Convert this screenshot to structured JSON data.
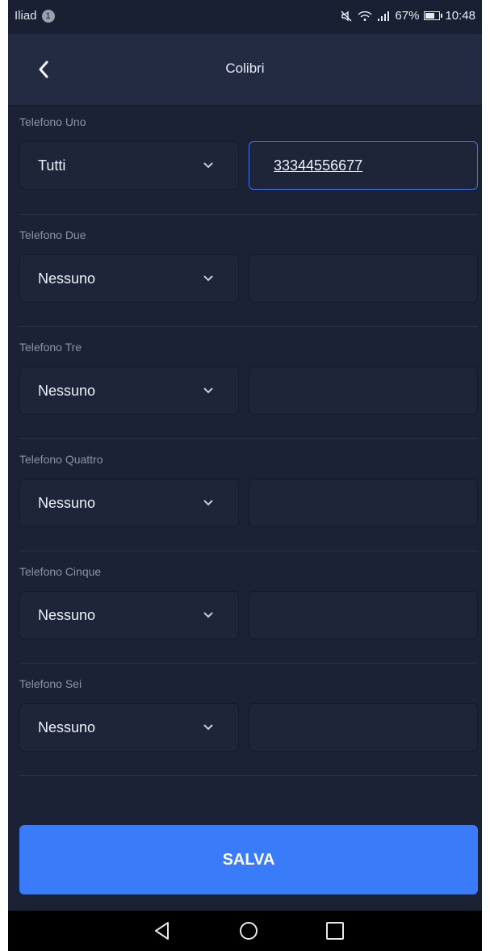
{
  "status_bar": {
    "carrier": "Iliad",
    "notification_count": "1",
    "battery": "67%",
    "time": "10:48",
    "battery_level": 0.67
  },
  "header": {
    "title": "Colibri"
  },
  "phones": [
    {
      "label": "Telefono Uno",
      "selected": "Tutti",
      "number": "33344556677"
    },
    {
      "label": "Telefono Due",
      "selected": "Nessuno",
      "number": ""
    },
    {
      "label": "Telefono Tre",
      "selected": "Nessuno",
      "number": ""
    },
    {
      "label": "Telefono Quattro",
      "selected": "Nessuno",
      "number": ""
    },
    {
      "label": "Telefono Cinque",
      "selected": "Nessuno",
      "number": ""
    },
    {
      "label": "Telefono Sei",
      "selected": "Nessuno",
      "number": ""
    }
  ],
  "save_label": "SALVA",
  "colors": {
    "accent": "#3a7bfa",
    "background": "#1b2236",
    "focus_border": "#3f73e6"
  }
}
